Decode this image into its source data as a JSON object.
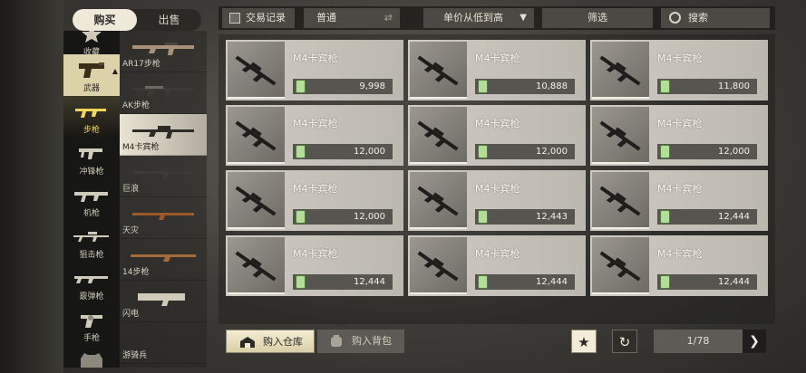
{
  "tabs": [
    {
      "label": "购买",
      "active": true
    },
    {
      "label": "出售",
      "active": false
    }
  ],
  "categories": [
    {
      "label": "收藏",
      "icon": "star-icon"
    },
    {
      "label": "武器",
      "icon": "pistol-icon",
      "state": "active"
    },
    {
      "label": "步枪",
      "icon": "rifle-icon",
      "state": "gold"
    },
    {
      "label": "冲锋枪",
      "icon": "smg-icon"
    },
    {
      "label": "机枪",
      "icon": "machine-gun-icon"
    },
    {
      "label": "狙击枪",
      "icon": "sniper-icon"
    },
    {
      "label": "霰弹枪",
      "icon": "shotgun-icon"
    },
    {
      "label": "手枪",
      "icon": "revolver-icon"
    },
    {
      "label": "",
      "icon": "vest-icon"
    }
  ],
  "subcategories": [
    {
      "label": "AR17步枪"
    },
    {
      "label": "AK步枪"
    },
    {
      "label": "M4卡宾枪",
      "active": true
    },
    {
      "label": "巨浪"
    },
    {
      "label": "天灾"
    },
    {
      "label": "14步枪"
    },
    {
      "label": "闪电"
    },
    {
      "label": "游骑兵"
    }
  ],
  "toolbar": {
    "history_label": "交易记录",
    "mode_label": "普通",
    "sort_label": "单价从低到高",
    "filter_label": "筛选",
    "search_label": "搜索"
  },
  "listings": [
    {
      "name": "M4卡宾枪",
      "price": "9,998"
    },
    {
      "name": "M4卡宾枪",
      "price": "10,888"
    },
    {
      "name": "M4卡宾枪",
      "price": "11,800"
    },
    {
      "name": "M4卡宾枪",
      "price": "12,000"
    },
    {
      "name": "M4卡宾枪",
      "price": "12,000"
    },
    {
      "name": "M4卡宾枪",
      "price": "12,000"
    },
    {
      "name": "M4卡宾枪",
      "price": "12,000"
    },
    {
      "name": "M4卡宾枪",
      "price": "12,443"
    },
    {
      "name": "M4卡宾枪",
      "price": "12,444"
    },
    {
      "name": "M4卡宾枪",
      "price": "12,444"
    },
    {
      "name": "M4卡宾枪",
      "price": "12,444"
    },
    {
      "name": "M4卡宾枪",
      "price": "12,444"
    }
  ],
  "bottom": {
    "warehouse_label": "购入仓库",
    "backpack_label": "购入背包",
    "page": "1/78"
  },
  "colors": {
    "active_tab": "#efe9da",
    "active_category": "#dcd2a9",
    "gold_label": "#f2d65a",
    "price_bar": "#57554f",
    "currency": "#b6dc9a"
  }
}
